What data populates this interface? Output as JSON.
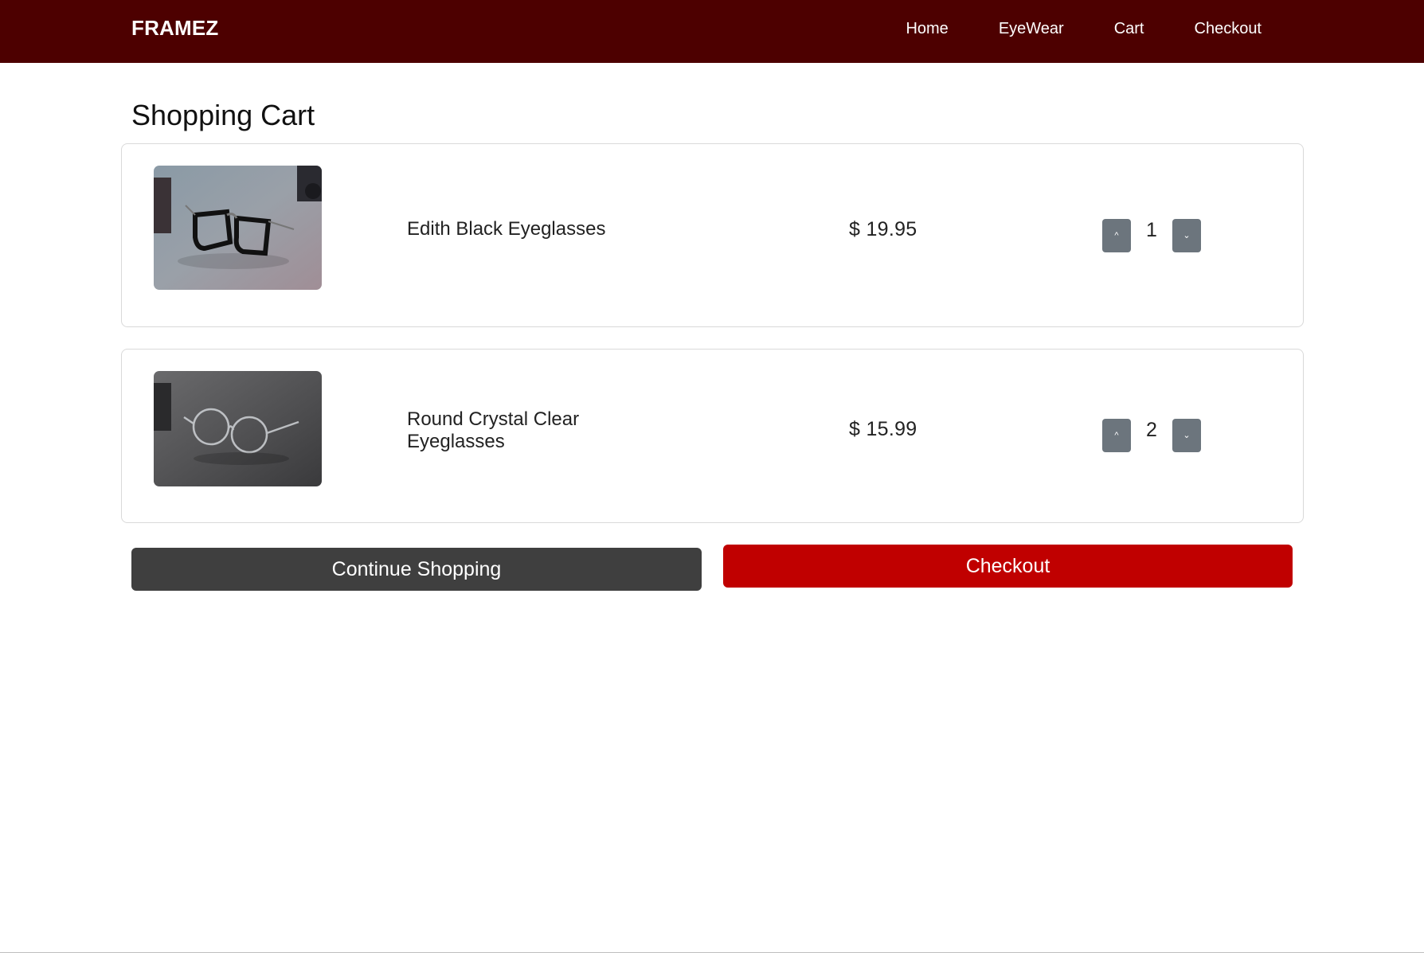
{
  "navbar": {
    "brand": "FRAMEZ",
    "links": [
      {
        "label": "Home"
      },
      {
        "label": "EyeWear"
      },
      {
        "label": "Cart"
      },
      {
        "label": "Checkout"
      }
    ],
    "background": "#4d0000"
  },
  "page": {
    "title": "Shopping Cart"
  },
  "cart": {
    "items": [
      {
        "name": "Edith Black Eyeglasses",
        "price": "$ 19.95",
        "quantity": "1",
        "image": "black-aviator-eyeglasses-photo"
      },
      {
        "name": "Round Crystal Clear Eyeglasses",
        "price": "$ 15.99",
        "quantity": "2",
        "image": "clear-round-eyeglasses-photo"
      }
    ],
    "qty_up_icon": "chevron-up-icon",
    "qty_down_icon": "chevron-down-icon",
    "qty_up_glyph": "^",
    "qty_down_glyph": "⌄"
  },
  "actions": {
    "continue_label": "Continue Shopping",
    "checkout_label": "Checkout",
    "continue_color": "#3f3f3f",
    "checkout_color": "#c00000"
  }
}
